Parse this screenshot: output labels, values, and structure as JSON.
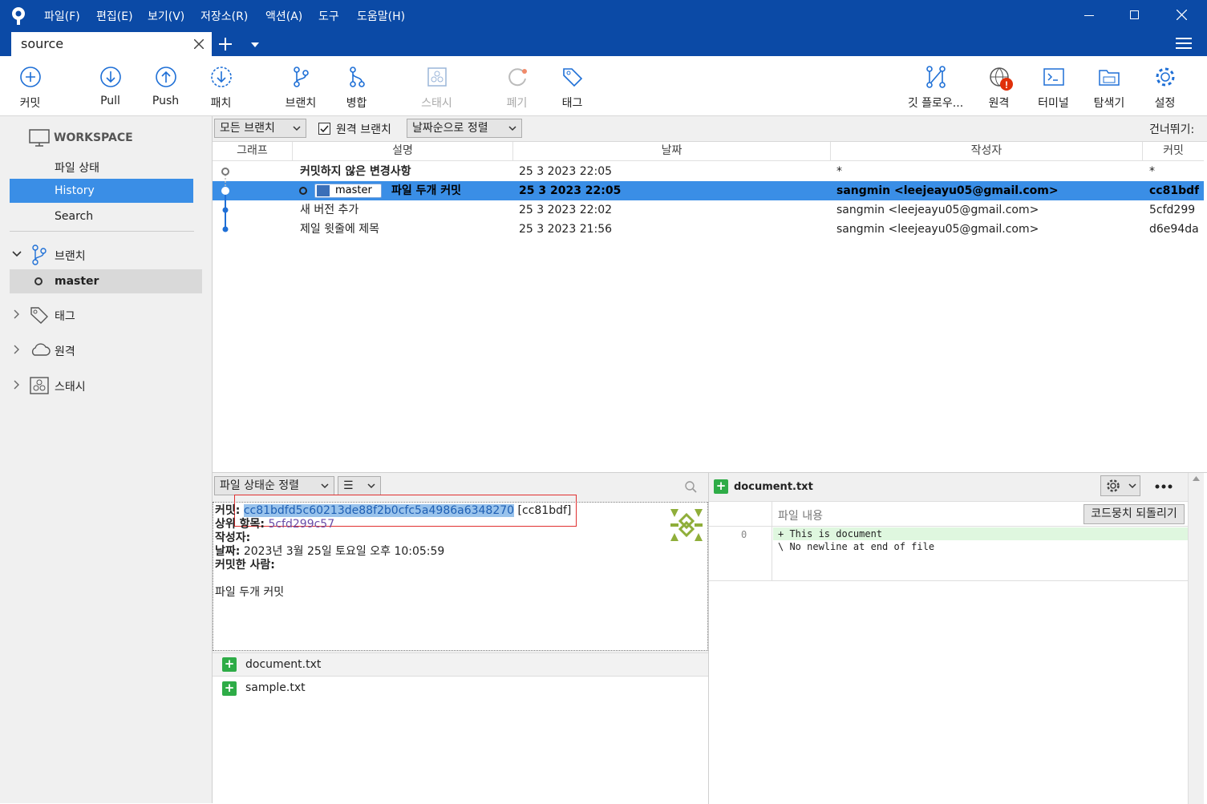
{
  "menu": [
    "파일(F)",
    "편집(E)",
    "보기(V)",
    "저장소(R)",
    "액션(A)",
    "도구",
    "도움말(H)"
  ],
  "tab": {
    "label": "source"
  },
  "toolbar": {
    "commit": "커밋",
    "pull": "Pull",
    "push": "Push",
    "patch": "패치",
    "branch": "브랜치",
    "merge": "병합",
    "stash": "스태시",
    "discard": "폐기",
    "tag": "태그",
    "gitflow": "깃 플로우...",
    "remote": "원격",
    "terminal": "터미널",
    "explorer": "탐색기",
    "settings": "설정"
  },
  "sidebar": {
    "workspace": "WORKSPACE",
    "file_status": "파일 상태",
    "history": "History",
    "search": "Search",
    "branches": "브랜치",
    "branch_master": "master",
    "tags": "태그",
    "remotes": "원격",
    "stashes": "스태시"
  },
  "filter": {
    "branches": "모든 브랜치",
    "remote_branches": "원격 브랜치",
    "sort": "날짜순으로 정렬",
    "jump": "건너뛰기:"
  },
  "columns": {
    "graph": "그래프",
    "desc": "설명",
    "date": "날짜",
    "author": "작성자",
    "commit": "커밋"
  },
  "rows": [
    {
      "desc": "커밋하지 않은 변경사항",
      "date": "25 3 2023 22:05",
      "author": "*",
      "commit": "*"
    },
    {
      "branch": "master",
      "desc": "파일 두개 커밋",
      "date": "25 3 2023 22:05",
      "author": "sangmin <leejeayu05@gmail.com>",
      "commit": "cc81bdf"
    },
    {
      "desc": "새 버전 추가",
      "date": "25 3 2023 22:02",
      "author": "sangmin <leejeayu05@gmail.com>",
      "commit": "5cfd299"
    },
    {
      "desc": "제일 윗줄에 제목",
      "date": "25 3 2023 21:56",
      "author": "sangmin <leejeayu05@gmail.com>",
      "commit": "d6e94da"
    }
  ],
  "bottom": {
    "sort": "파일 상태순 정렬",
    "view": "☰",
    "commit_label": "커밋:",
    "commit_hash": "cc81bdfd5c60213de88f2b0cfc5a4986a6348270",
    "commit_short": "[cc81bdf]",
    "parent_label": "상위 항목:",
    "parent_hash": "5cfd299c57",
    "author_label": "작성자:",
    "date_label": "날짜:",
    "date_value": "2023년 3월 25일 토요일 오후 10:05:59",
    "committer_label": "커밋한 사람:",
    "message": "파일 두개 커밋",
    "files": [
      "document.txt",
      "sample.txt"
    ]
  },
  "diff": {
    "file": "document.txt",
    "header": "파일 내용",
    "revert": "코드뭉치 되돌리기",
    "line_no": "0",
    "line1": "+ This is document",
    "line2": "\\ No newline at end of file"
  },
  "colors": {
    "accent": "#0b4aa6",
    "selection": "#3a8ee6",
    "sidebar_sel": "#3a8ee6",
    "add": "#2eac47"
  }
}
